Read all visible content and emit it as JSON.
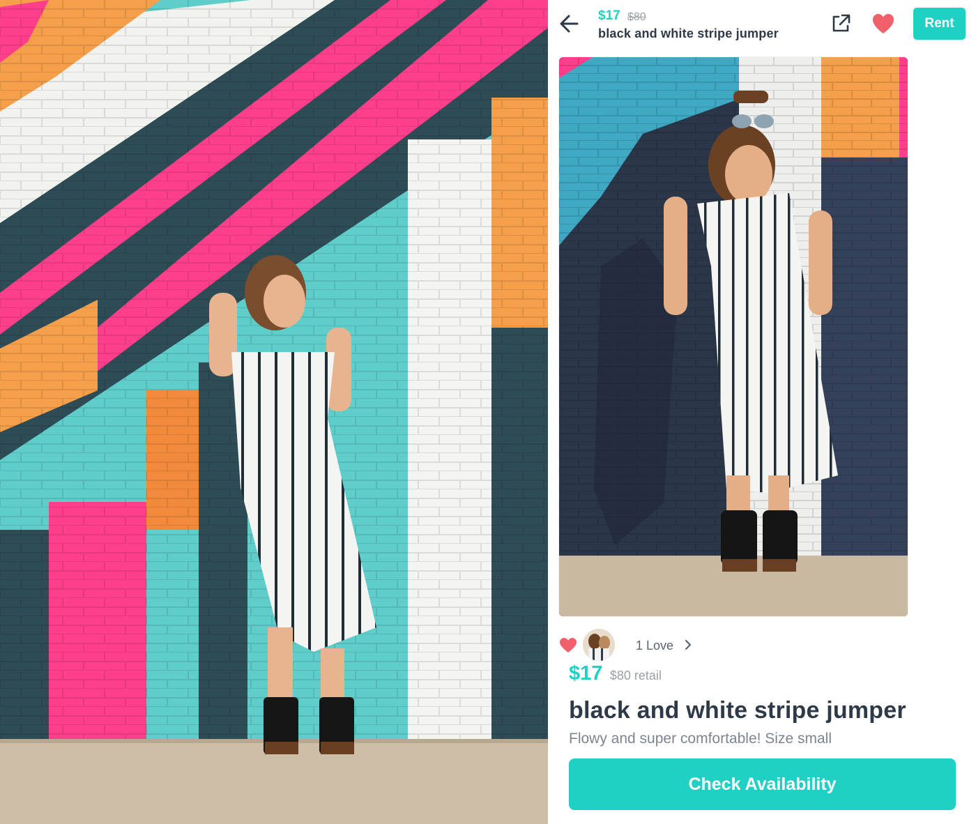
{
  "header": {
    "price": "$17",
    "retail_price": "$80",
    "title": "black and white stripe jumper",
    "rent_label": "Rent",
    "icons": {
      "back": "arrow-left-icon",
      "share": "external-share-icon",
      "favorite": "heart-icon"
    }
  },
  "loves": {
    "count_label": "1 Love"
  },
  "listing": {
    "price": "$17",
    "retail": "$80 retail",
    "title": "black and white stripe jumper",
    "description": "Flowy and super comfortable! Size small"
  },
  "cta": {
    "label": "Check Availability"
  },
  "colors": {
    "accent": "#1fd1c4",
    "heart": "#f0606b",
    "title_text": "#2f3a48",
    "muted_text": "#9aa0a6"
  }
}
